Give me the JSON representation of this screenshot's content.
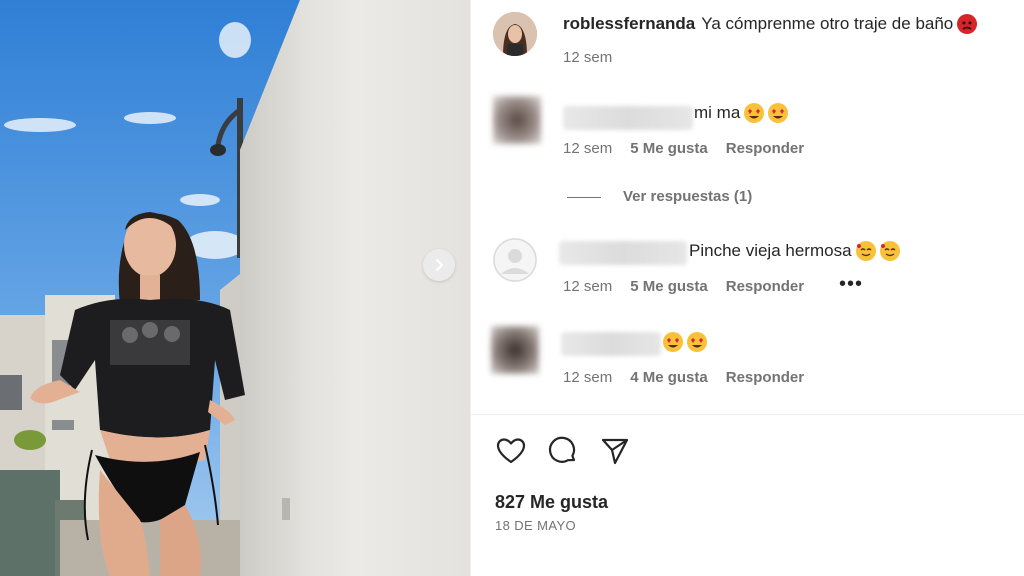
{
  "post": {
    "author": "roblessfernanda",
    "caption": "Ya cómprenme otro traje de baño",
    "caption_emoji": "angry-face-emoji",
    "time": "12 sem"
  },
  "comments": [
    {
      "text": "mi ma",
      "emojis": [
        "heart-eyes-emoji",
        "heart-eyes-emoji"
      ],
      "time": "12 sem",
      "likes": "5 Me gusta",
      "reply": "Responder",
      "view_replies": "Ver respuestas (1)"
    },
    {
      "text": "Pinche vieja hermosa",
      "emojis": [
        "smiling-hearts-emoji",
        "smiling-hearts-emoji"
      ],
      "time": "12 sem",
      "likes": "5 Me gusta",
      "reply": "Responder",
      "more": "•••"
    },
    {
      "text": "",
      "emojis": [
        "heart-eyes-emoji",
        "heart-eyes-emoji"
      ],
      "time": "12 sem",
      "likes": "4 Me gusta",
      "reply": "Responder"
    }
  ],
  "footer": {
    "likes": "827 Me gusta",
    "date": "18 DE MAYO"
  },
  "icons": {
    "like": "heart-icon",
    "comment": "comment-icon",
    "share": "send-icon",
    "next": "chevron-right-icon"
  },
  "colors": {
    "text": "#262626",
    "secondary": "#737373",
    "sky": "#4a90d9",
    "wall": "#e9e7e3"
  }
}
